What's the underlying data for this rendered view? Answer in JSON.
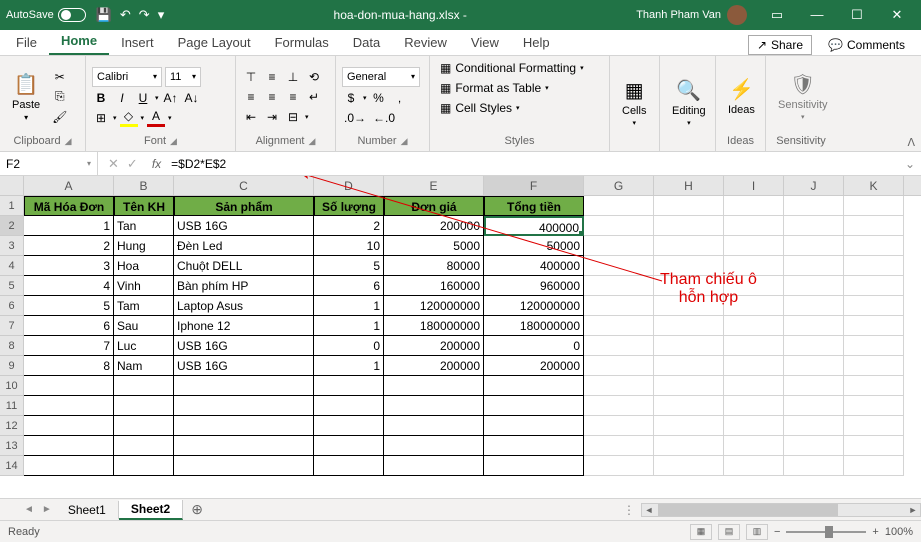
{
  "titlebar": {
    "autosave": "AutoSave",
    "filename": "hoa-don-mua-hang.xlsx  -",
    "username": "Thanh Pham Van"
  },
  "tabs": {
    "file": "File",
    "home": "Home",
    "insert": "Insert",
    "pagelayout": "Page Layout",
    "formulas": "Formulas",
    "data": "Data",
    "review": "Review",
    "view": "View",
    "help": "Help",
    "share": "Share",
    "comments": "Comments"
  },
  "ribbon": {
    "clipboard": "Clipboard",
    "paste": "Paste",
    "font": "Font",
    "fontname": "Calibri",
    "fontsize": "11",
    "alignment": "Alignment",
    "number": "Number",
    "numfmt": "General",
    "styles": "Styles",
    "condfmt": "Conditional Formatting",
    "fmttable": "Format as Table",
    "cellstyles": "Cell Styles",
    "cells": "Cells",
    "editing": "Editing",
    "ideas": "Ideas",
    "sensitivity": "Sensitivity"
  },
  "namebox": "F2",
  "formula": "=$D2*E$2",
  "cols": [
    "A",
    "B",
    "C",
    "D",
    "E",
    "F",
    "G",
    "H",
    "I",
    "J",
    "K"
  ],
  "headers": [
    "Mã Hóa Đơn",
    "Tên KH",
    "Sản phẩm",
    "Số lượng",
    "Đơn giá",
    "Tổng tiền"
  ],
  "rows": [
    {
      "id": "1",
      "kh": "Tan",
      "sp": "USB 16G",
      "sl": "2",
      "dg": "200000",
      "tt": "400000"
    },
    {
      "id": "2",
      "kh": "Hung",
      "sp": "Đèn Led",
      "sl": "10",
      "dg": "5000",
      "tt": "50000"
    },
    {
      "id": "3",
      "kh": "Hoa",
      "sp": "Chuột DELL",
      "sl": "5",
      "dg": "80000",
      "tt": "400000"
    },
    {
      "id": "4",
      "kh": "Vinh",
      "sp": "Bàn phím HP",
      "sl": "6",
      "dg": "160000",
      "tt": "960000"
    },
    {
      "id": "5",
      "kh": "Tam",
      "sp": "Laptop Asus",
      "sl": "1",
      "dg": "120000000",
      "tt": "120000000"
    },
    {
      "id": "6",
      "kh": "Sau",
      "sp": "Iphone 12",
      "sl": "1",
      "dg": "180000000",
      "tt": "180000000"
    },
    {
      "id": "7",
      "kh": "Luc",
      "sp": "USB 16G",
      "sl": "0",
      "dg": "200000",
      "tt": "0"
    },
    {
      "id": "8",
      "kh": "Nam",
      "sp": "USB 16G",
      "sl": "1",
      "dg": "200000",
      "tt": "200000"
    }
  ],
  "annotation": {
    "line1": "Tham chiếu ô",
    "line2": "hỗn hợp"
  },
  "sheets": {
    "s1": "Sheet1",
    "s2": "Sheet2"
  },
  "status": {
    "ready": "Ready",
    "zoom": "100%"
  }
}
